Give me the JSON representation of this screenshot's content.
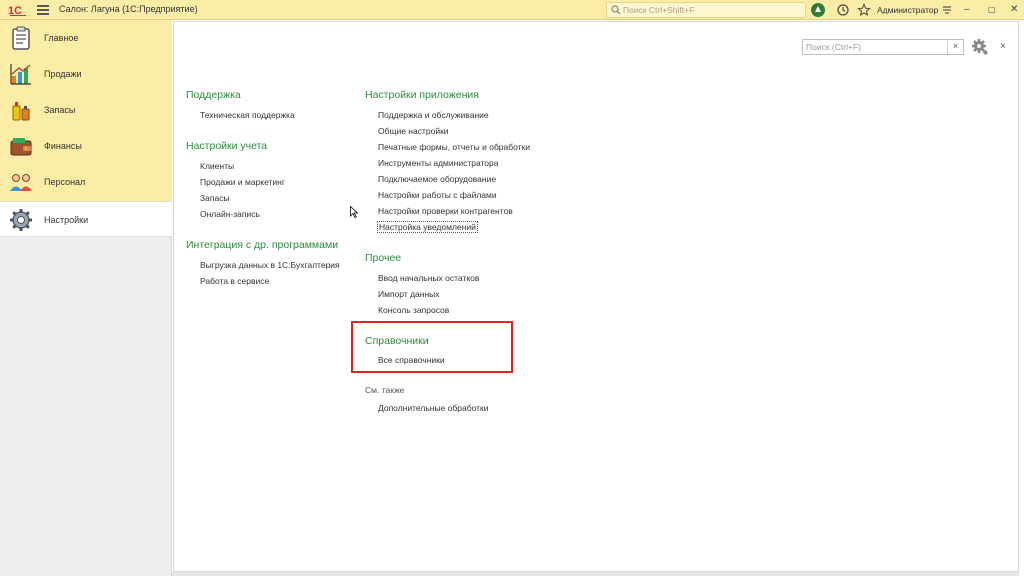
{
  "app": {
    "title": "Салон: Лагуна  (1С:Предприятие)",
    "search_placeholder": "Поиск Ctrl+Shift+F",
    "user": "Администратор",
    "brand_color": "#fbeca6"
  },
  "sidebar": {
    "items": [
      {
        "label": "Главное",
        "icon": "clipboard-icon"
      },
      {
        "label": "Продажи",
        "icon": "chart-icon"
      },
      {
        "label": "Запасы",
        "icon": "products-icon"
      },
      {
        "label": "Финансы",
        "icon": "wallet-icon"
      },
      {
        "label": "Персонал",
        "icon": "people-icon"
      },
      {
        "label": "Настройки",
        "icon": "gear-icon",
        "active": true
      }
    ]
  },
  "form": {
    "search_placeholder": "Поиск (Ctrl+F)",
    "clear": "×",
    "close": "×"
  },
  "sections": {
    "support": {
      "title": "Поддержка",
      "links": [
        "Техническая поддержка"
      ]
    },
    "accounting": {
      "title": "Настройки учета",
      "links": [
        "Клиенты",
        "Продажи и маркетинг",
        "Запасы",
        "Онлайн-запись"
      ]
    },
    "integration": {
      "title": "Интеграция с др. программами",
      "links": [
        "Выгрузка данных в 1С:Бухгалтерия",
        "Работа в сервисе"
      ]
    },
    "app_settings": {
      "title": "Настройки приложения",
      "links": [
        "Поддержка и обслуживание",
        "Общие настройки",
        "Печатные формы, отчеты и обработки",
        "Инструменты администратора",
        "Подключаемое оборудование",
        "Настройки работы с файлами",
        "Настройки проверки контрагентов",
        "Настройка уведомлений"
      ]
    },
    "other": {
      "title": "Прочее",
      "links": [
        "Ввод начальных остатков",
        "Импорт данных",
        "Консоль запросов"
      ]
    },
    "directories": {
      "title": "Справочники",
      "links": [
        "Все справочники"
      ]
    },
    "see_also": {
      "title": "См. также",
      "links": [
        "Дополнительные обработки"
      ]
    }
  },
  "highlight_color": "#e02424"
}
